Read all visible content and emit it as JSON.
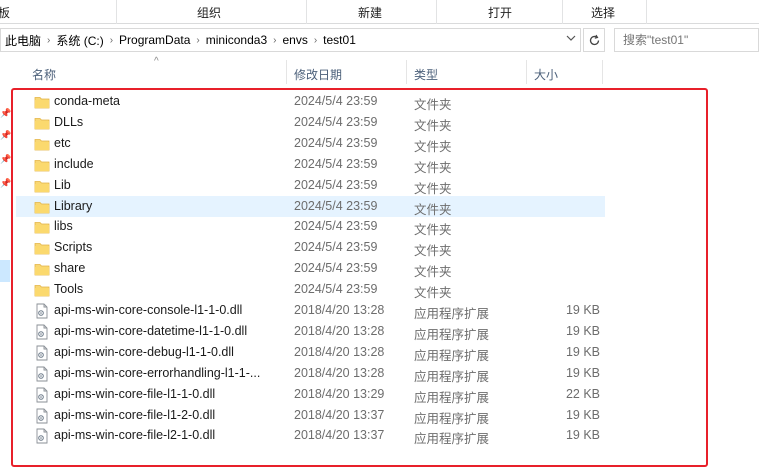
{
  "ribbon": {
    "groups": [
      "板",
      "组织",
      "新建",
      "打开",
      "选择"
    ]
  },
  "address": {
    "crumbs": [
      "此电脑",
      "系统 (C:)",
      "ProgramData",
      "miniconda3",
      "envs",
      "test01"
    ],
    "dropdown_icon": "chevron-down-icon",
    "refresh_icon": "refresh-icon"
  },
  "search": {
    "placeholder": "搜索\"test01\""
  },
  "columns": {
    "name": "名称",
    "date": "修改日期",
    "type": "类型",
    "size": "大小"
  },
  "files": [
    {
      "name": "conda-meta",
      "date": "2024/5/4 23:59",
      "type": "文件夹",
      "size": "",
      "icon": "folder-icon"
    },
    {
      "name": "DLLs",
      "date": "2024/5/4 23:59",
      "type": "文件夹",
      "size": "",
      "icon": "folder-icon"
    },
    {
      "name": "etc",
      "date": "2024/5/4 23:59",
      "type": "文件夹",
      "size": "",
      "icon": "folder-icon"
    },
    {
      "name": "include",
      "date": "2024/5/4 23:59",
      "type": "文件夹",
      "size": "",
      "icon": "folder-icon"
    },
    {
      "name": "Lib",
      "date": "2024/5/4 23:59",
      "type": "文件夹",
      "size": "",
      "icon": "folder-icon"
    },
    {
      "name": "Library",
      "date": "2024/5/4 23:59",
      "type": "文件夹",
      "size": "",
      "icon": "folder-icon",
      "selected": true
    },
    {
      "name": "libs",
      "date": "2024/5/4 23:59",
      "type": "文件夹",
      "size": "",
      "icon": "folder-icon"
    },
    {
      "name": "Scripts",
      "date": "2024/5/4 23:59",
      "type": "文件夹",
      "size": "",
      "icon": "folder-icon"
    },
    {
      "name": "share",
      "date": "2024/5/4 23:59",
      "type": "文件夹",
      "size": "",
      "icon": "folder-icon"
    },
    {
      "name": "Tools",
      "date": "2024/5/4 23:59",
      "type": "文件夹",
      "size": "",
      "icon": "folder-icon"
    },
    {
      "name": "api-ms-win-core-console-l1-1-0.dll",
      "date": "2018/4/20 13:28",
      "type": "应用程序扩展",
      "size": "19 KB",
      "icon": "dll-file-icon"
    },
    {
      "name": "api-ms-win-core-datetime-l1-1-0.dll",
      "date": "2018/4/20 13:28",
      "type": "应用程序扩展",
      "size": "19 KB",
      "icon": "dll-file-icon"
    },
    {
      "name": "api-ms-win-core-debug-l1-1-0.dll",
      "date": "2018/4/20 13:28",
      "type": "应用程序扩展",
      "size": "19 KB",
      "icon": "dll-file-icon"
    },
    {
      "name": "api-ms-win-core-errorhandling-l1-1-...",
      "date": "2018/4/20 13:28",
      "type": "应用程序扩展",
      "size": "19 KB",
      "icon": "dll-file-icon"
    },
    {
      "name": "api-ms-win-core-file-l1-1-0.dll",
      "date": "2018/4/20 13:29",
      "type": "应用程序扩展",
      "size": "22 KB",
      "icon": "dll-file-icon"
    },
    {
      "name": "api-ms-win-core-file-l1-2-0.dll",
      "date": "2018/4/20 13:37",
      "type": "应用程序扩展",
      "size": "19 KB",
      "icon": "dll-file-icon"
    },
    {
      "name": "api-ms-win-core-file-l2-1-0.dll",
      "date": "2018/4/20 13:37",
      "type": "应用程序扩展",
      "size": "19 KB",
      "icon": "dll-file-icon"
    }
  ],
  "colors": {
    "annotation_red": "#e8202a",
    "folder_yellow": "#f8d775",
    "selection_blue": "#e5f3ff",
    "header_text": "#4c607a"
  }
}
